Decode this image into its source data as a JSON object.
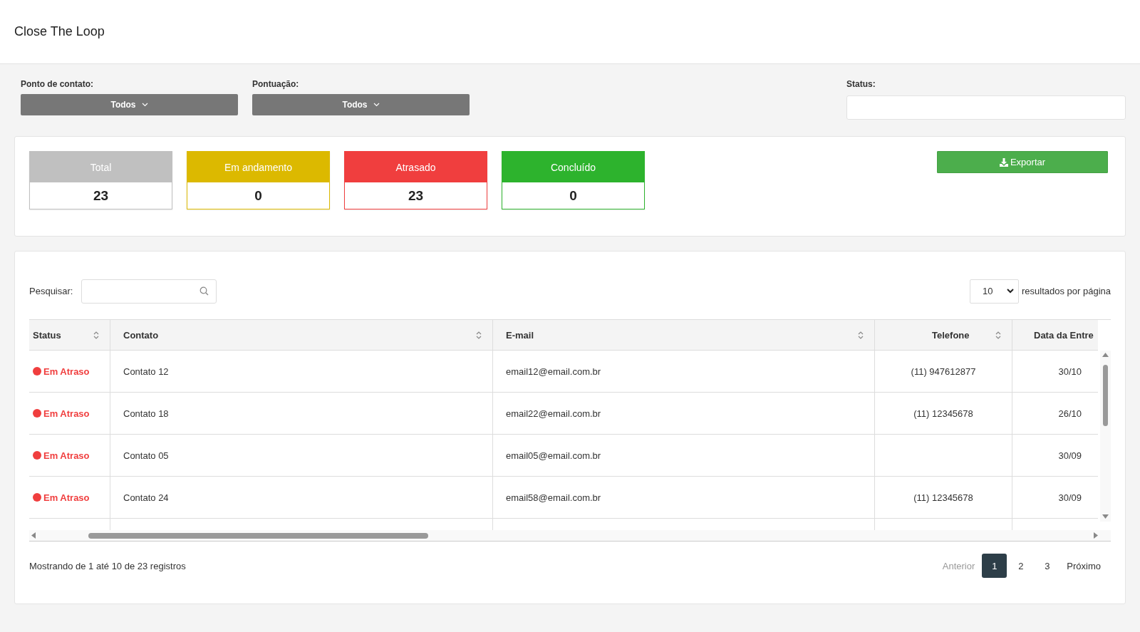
{
  "header": {
    "title": "Close The Loop"
  },
  "filters": [
    {
      "kind": "dropdown",
      "label": "Ponto de contato:",
      "value": "Todos"
    },
    {
      "kind": "dropdown",
      "label": "Pontuação:",
      "value": "Todos"
    },
    {
      "kind": "input",
      "label": "Status:"
    }
  ],
  "summary": {
    "cards": [
      {
        "label": "Total",
        "value": "23",
        "color": "#c0c0c0"
      },
      {
        "label": "Em andamento",
        "value": "0",
        "color": "#dcb900"
      },
      {
        "label": "Atrasado",
        "value": "23",
        "color": "#f03e3e"
      },
      {
        "label": "Concluído",
        "value": "0",
        "color": "#2db32d"
      }
    ],
    "export_button": "Exportar"
  },
  "table": {
    "search_label": "Pesquisar:",
    "page_size": "10",
    "page_size_label": "resultados por página",
    "columns": [
      {
        "label": "Status",
        "sortable": true
      },
      {
        "label": "Contato",
        "sortable": true
      },
      {
        "label": "E-mail",
        "sortable": true
      },
      {
        "label": "Telefone",
        "sortable": true
      },
      {
        "label": "Data da Entre"
      }
    ],
    "rows": [
      {
        "status": "Em Atraso",
        "color": "#f03e3e",
        "contato": "Contato 12",
        "email": "email12@email.com.br",
        "telefone": "(11) 947612877",
        "data": "30/10"
      },
      {
        "status": "Em Atraso",
        "color": "#f03e3e",
        "contato": "Contato 18",
        "email": "email22@email.com.br",
        "telefone": "(11) 12345678",
        "data": "26/10"
      },
      {
        "status": "Em Atraso",
        "color": "#f03e3e",
        "contato": "Contato 05",
        "email": "email05@email.com.br",
        "data": "30/09"
      },
      {
        "status": "Em Atraso",
        "color": "#f03e3e",
        "contato": "Contato 24",
        "email": "email58@email.com.br",
        "telefone": "(11) 12345678",
        "data": "30/09"
      }
    ],
    "info": "Mostrando de 1 até 10 de 23 registros",
    "pagination": {
      "previous": {
        "label": "Anterior",
        "disabled": true
      },
      "pages": [
        {
          "label": "1",
          "selected": true
        },
        {
          "label": "2",
          "selected": false
        },
        {
          "label": "3",
          "selected": false
        }
      ],
      "next": {
        "label": "Próximo",
        "disabled": false
      }
    }
  }
}
